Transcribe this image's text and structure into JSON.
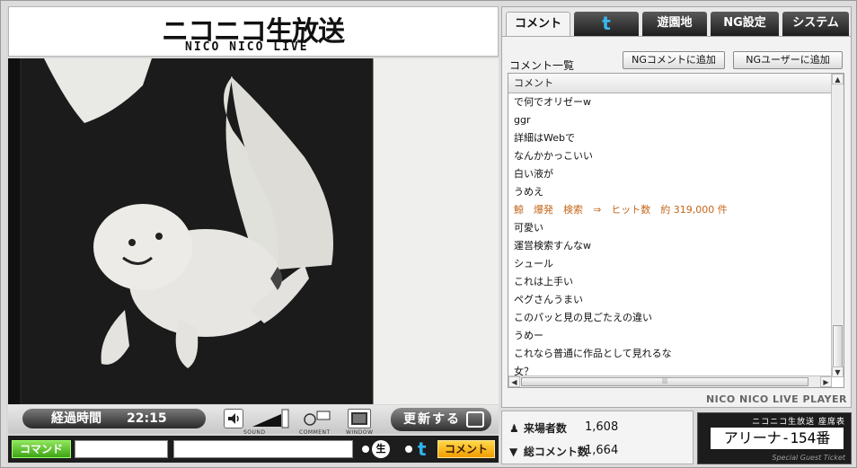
{
  "brand": {
    "logo_text": "ニコニコ生放送",
    "logo_sub": "NICO NICO LIVE"
  },
  "controls": {
    "elapsed_label": "経過時間",
    "elapsed_time": "22:15",
    "sound_caption": "SOUND",
    "comment_caption": "COMMENT",
    "window_caption": "WINDOW",
    "refresh_label": "更新する"
  },
  "command_bar": {
    "command_button": "コマンド",
    "command_value": "",
    "comment_value": "",
    "nama_icon": "生",
    "post_button": "コメント"
  },
  "tabs": [
    {
      "label": "コメント",
      "active": true
    },
    {
      "label": "t",
      "icon": "twitter-icon"
    },
    {
      "label": "遊園地"
    },
    {
      "label": "NG設定"
    },
    {
      "label": "システム"
    }
  ],
  "comment_panel": {
    "list_title": "コメント一覧",
    "add_ng_comment": "NGコメントに追加",
    "add_ng_user": "NGユーザーに追加",
    "column_header": "コメント",
    "comments": [
      {
        "text": "で何でオリゼーw"
      },
      {
        "text": "ggr"
      },
      {
        "text": "詳細はWebで"
      },
      {
        "text": "なんかかっこいい"
      },
      {
        "text": "白い液が"
      },
      {
        "text": "うめえ"
      },
      {
        "text": "鯨　爆発　検索　⇒　ヒット数　約 319,000 件",
        "system": true
      },
      {
        "text": "可愛い"
      },
      {
        "text": "運営検索すんなw"
      },
      {
        "text": "シュール"
      },
      {
        "text": "これは上手い"
      },
      {
        "text": "ペグさんうまい"
      },
      {
        "text": "このパッと見の見ごたえの違い"
      },
      {
        "text": "うめー"
      },
      {
        "text": "これなら普通に作品として見れるな"
      },
      {
        "text": "女？"
      }
    ],
    "player_label": "NICO NICO LIVE PLAYER"
  },
  "stats": {
    "visitors_label": "来場者数",
    "visitors_value": "1,608",
    "comments_label": "総コメント数",
    "comments_value": "1,664"
  },
  "ticket": {
    "header": "ニコニコ生放送 座席表",
    "seat": "アリーナ-154番",
    "footer": "Special Guest Ticket"
  }
}
